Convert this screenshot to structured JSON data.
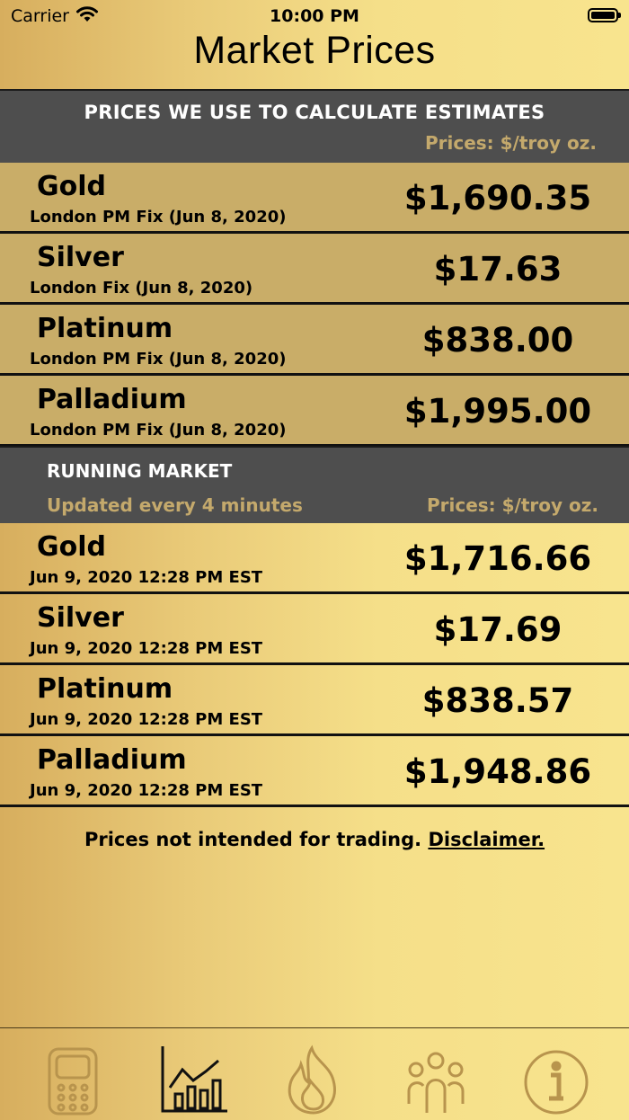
{
  "status_bar": {
    "carrier": "Carrier",
    "time": "10:00 PM"
  },
  "title": "Market Prices",
  "fixed_section": {
    "title": "PRICES WE USE TO CALCULATE ESTIMATES",
    "units": "Prices: $/troy oz.",
    "rows": [
      {
        "metal": "Gold",
        "source": "London PM Fix (Jun 8, 2020)",
        "price": "$1,690.35"
      },
      {
        "metal": "Silver",
        "source": "London Fix (Jun 8, 2020)",
        "price": "$17.63"
      },
      {
        "metal": "Platinum",
        "source": "London PM Fix (Jun 8, 2020)",
        "price": "$838.00"
      },
      {
        "metal": "Palladium",
        "source": "London PM Fix (Jun 8, 2020)",
        "price": "$1,995.00"
      }
    ]
  },
  "running_section": {
    "title": "RUNNING MARKET",
    "subtitle": "Updated every 4 minutes",
    "units": "Prices: $/troy oz.",
    "rows": [
      {
        "metal": "Gold",
        "source": "Jun 9, 2020 12:28 PM EST",
        "price": "$1,716.66"
      },
      {
        "metal": "Silver",
        "source": "Jun 9, 2020 12:28 PM EST",
        "price": "$17.69"
      },
      {
        "metal": "Platinum",
        "source": "Jun 9, 2020 12:28 PM EST",
        "price": "$838.57"
      },
      {
        "metal": "Palladium",
        "source": "Jun 9, 2020 12:28 PM EST",
        "price": "$1,948.86"
      }
    ]
  },
  "footer": {
    "note": "Prices not intended for trading.",
    "link": "Disclaimer."
  },
  "tabs": [
    {
      "icon": "calculator-icon",
      "selected": false
    },
    {
      "icon": "bar-chart-icon",
      "selected": true
    },
    {
      "icon": "flame-icon",
      "selected": false
    },
    {
      "icon": "people-icon",
      "selected": false
    },
    {
      "icon": "info-icon",
      "selected": false
    }
  ],
  "colors": {
    "header_bg": "#4e4e4e",
    "header_units": "#c4a96c",
    "fixed_row_bg": "#c9ad68",
    "tab_inactive": "#b8944d",
    "tab_active": "#111111"
  }
}
